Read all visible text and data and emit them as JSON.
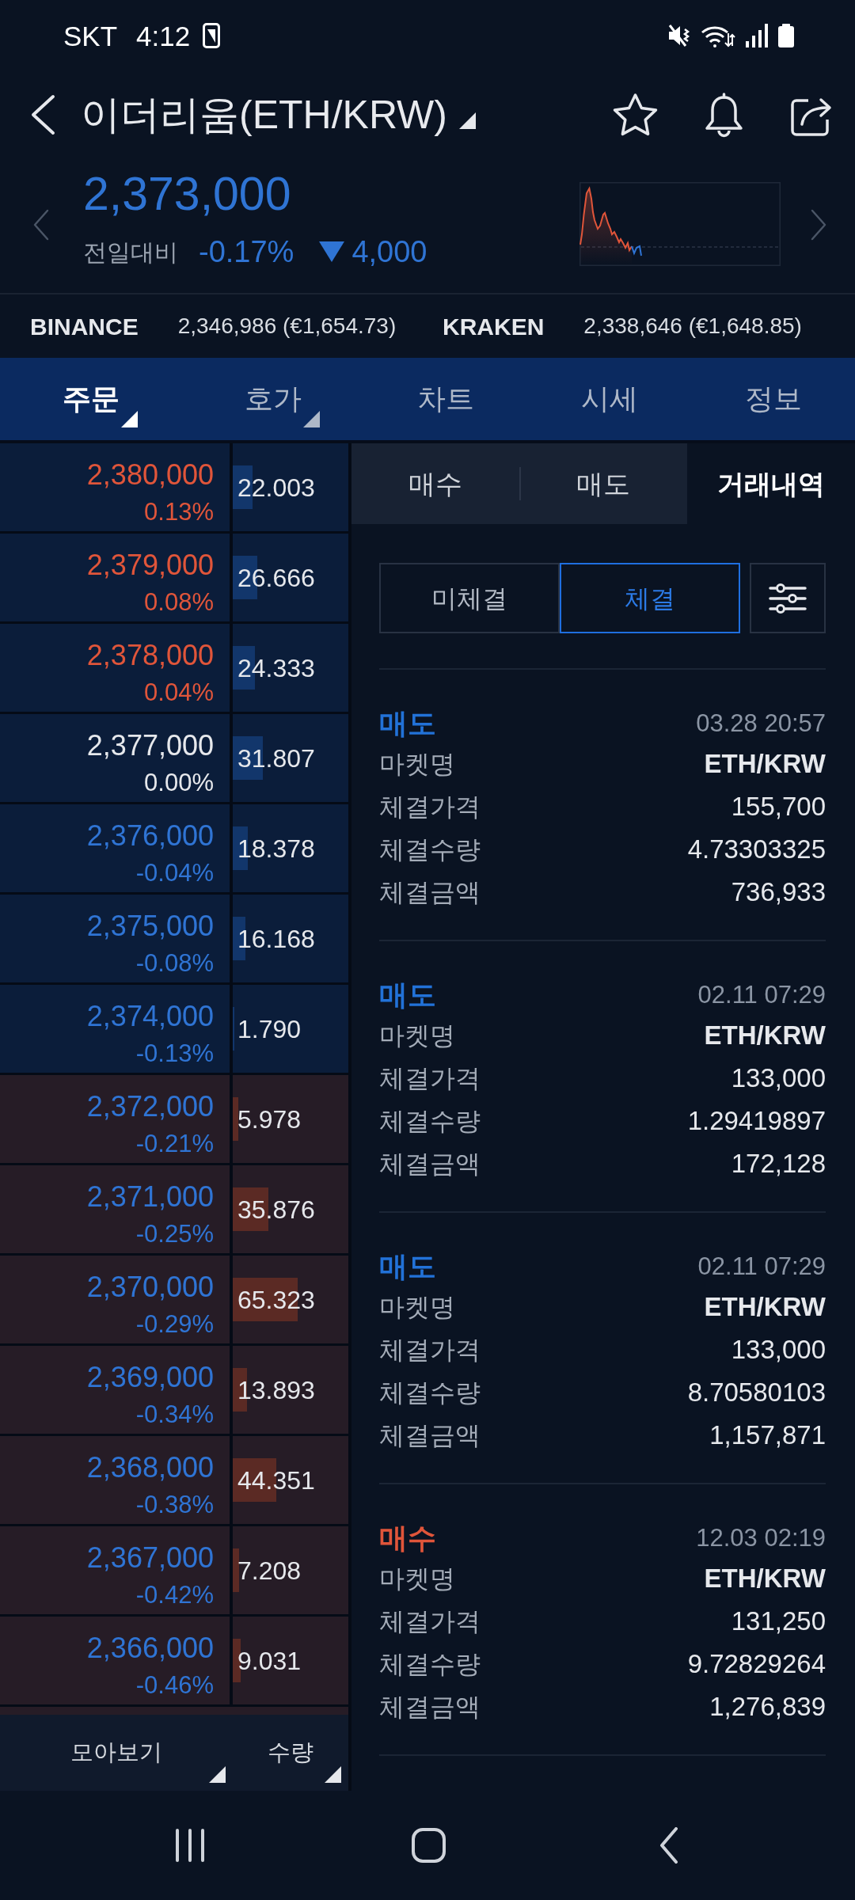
{
  "status_bar": {
    "carrier": "SKT",
    "time": "4:12"
  },
  "header": {
    "title": "이더리움(ETH/KRW)",
    "dropdown": true
  },
  "ticker": {
    "price": "2,373,000",
    "falling": true,
    "change_label": "전일대비",
    "change_percent": "-0.17%",
    "change_amount": "4,000"
  },
  "exchanges": [
    {
      "name": "BINANCE",
      "quote": "2,346,986 (€1,654.73)"
    },
    {
      "name": "KRAKEN",
      "quote": "2,338,646 (€1,648.85)"
    }
  ],
  "tabs": [
    {
      "label": "주문",
      "selected": true,
      "dropdown": true
    },
    {
      "label": "호가",
      "selected": false,
      "dropdown": true
    },
    {
      "label": "차트",
      "selected": false,
      "dropdown": false
    },
    {
      "label": "시세",
      "selected": false,
      "dropdown": false
    },
    {
      "label": "정보",
      "selected": false,
      "dropdown": false
    }
  ],
  "order_book": {
    "rows": [
      {
        "kind": "ask",
        "price": "2,380,000",
        "change": "0.13%",
        "color": "#e0553a",
        "volume": "22.003",
        "level": 0.17
      },
      {
        "kind": "ask",
        "price": "2,379,000",
        "change": "0.08%",
        "color": "#e0553a",
        "volume": "26.666",
        "level": 0.21
      },
      {
        "kind": "ask",
        "price": "2,378,000",
        "change": "0.04%",
        "color": "#e0553a",
        "volume": "24.333",
        "level": 0.19
      },
      {
        "kind": "ask",
        "price": "2,377,000",
        "change": "0.00%",
        "color": "#e6e8ec",
        "volume": "31.807",
        "level": 0.26
      },
      {
        "kind": "ask",
        "price": "2,376,000",
        "change": "-0.04%",
        "color": "#2f74d4",
        "volume": "18.378",
        "level": 0.13
      },
      {
        "kind": "ask",
        "price": "2,375,000",
        "change": "-0.08%",
        "color": "#2f74d4",
        "volume": "16.168",
        "level": 0.11
      },
      {
        "kind": "ask",
        "price": "2,374,000",
        "change": "-0.13%",
        "color": "#2f74d4",
        "volume": "1.790",
        "level": 0.015
      },
      {
        "kind": "bid",
        "price": "2,372,000",
        "change": "-0.21%",
        "color": "#2f74d4",
        "volume": "5.978",
        "level": 0.045
      },
      {
        "kind": "bid",
        "price": "2,371,000",
        "change": "-0.25%",
        "color": "#2f74d4",
        "volume": "35.876",
        "level": 0.31
      },
      {
        "kind": "bid",
        "price": "2,370,000",
        "change": "-0.29%",
        "color": "#2f74d4",
        "volume": "65.323",
        "level": 0.56
      },
      {
        "kind": "bid",
        "price": "2,369,000",
        "change": "-0.34%",
        "color": "#2f74d4",
        "volume": "13.893",
        "level": 0.12
      },
      {
        "kind": "bid",
        "price": "2,368,000",
        "change": "-0.38%",
        "color": "#2f74d4",
        "volume": "44.351",
        "level": 0.38
      },
      {
        "kind": "bid",
        "price": "2,367,000",
        "change": "-0.42%",
        "color": "#2f74d4",
        "volume": "7.208",
        "level": 0.055
      },
      {
        "kind": "bid",
        "price": "2,366,000",
        "change": "-0.46%",
        "color": "#2f74d4",
        "volume": "9.031",
        "level": 0.07
      }
    ],
    "footer": [
      {
        "label": "모아보기",
        "dropdown": true
      },
      {
        "label": "수량",
        "dropdown": true
      }
    ]
  },
  "trade_panel": {
    "tabs": [
      {
        "label": "매수",
        "selected": false
      },
      {
        "label": "매도",
        "selected": false
      },
      {
        "label": "거래내역",
        "selected": true
      }
    ],
    "filters": [
      {
        "label": "미체결",
        "selected": false
      },
      {
        "label": "체결",
        "selected": true
      }
    ],
    "trades": [
      {
        "kind": "sell",
        "type": "매도",
        "time": "03.28 20:57",
        "fields": [
          {
            "label": "마켓명",
            "value": "ETH/KRW",
            "kind": "market"
          },
          {
            "label": "체결가격",
            "value": "155,700",
            "kind": "number"
          },
          {
            "label": "체결수량",
            "value": "4.73303325",
            "kind": "number"
          },
          {
            "label": "체결금액",
            "value": "736,933",
            "kind": "number"
          }
        ]
      },
      {
        "kind": "sell",
        "type": "매도",
        "time": "02.11 07:29",
        "fields": [
          {
            "label": "마켓명",
            "value": "ETH/KRW",
            "kind": "market"
          },
          {
            "label": "체결가격",
            "value": "133,000",
            "kind": "number"
          },
          {
            "label": "체결수량",
            "value": "1.29419897",
            "kind": "number"
          },
          {
            "label": "체결금액",
            "value": "172,128",
            "kind": "number"
          }
        ]
      },
      {
        "kind": "sell",
        "type": "매도",
        "time": "02.11 07:29",
        "fields": [
          {
            "label": "마켓명",
            "value": "ETH/KRW",
            "kind": "market"
          },
          {
            "label": "체결가격",
            "value": "133,000",
            "kind": "number"
          },
          {
            "label": "체결수량",
            "value": "8.70580103",
            "kind": "number"
          },
          {
            "label": "체결금액",
            "value": "1,157,871",
            "kind": "number"
          }
        ]
      },
      {
        "kind": "buy",
        "type": "매수",
        "time": "12.03 02:19",
        "fields": [
          {
            "label": "마켓명",
            "value": "ETH/KRW",
            "kind": "market"
          },
          {
            "label": "체결가격",
            "value": "131,250",
            "kind": "number"
          },
          {
            "label": "체결수량",
            "value": "9.72829264",
            "kind": "number"
          },
          {
            "label": "체결금액",
            "value": "1,276,839",
            "kind": "number"
          }
        ]
      }
    ]
  }
}
